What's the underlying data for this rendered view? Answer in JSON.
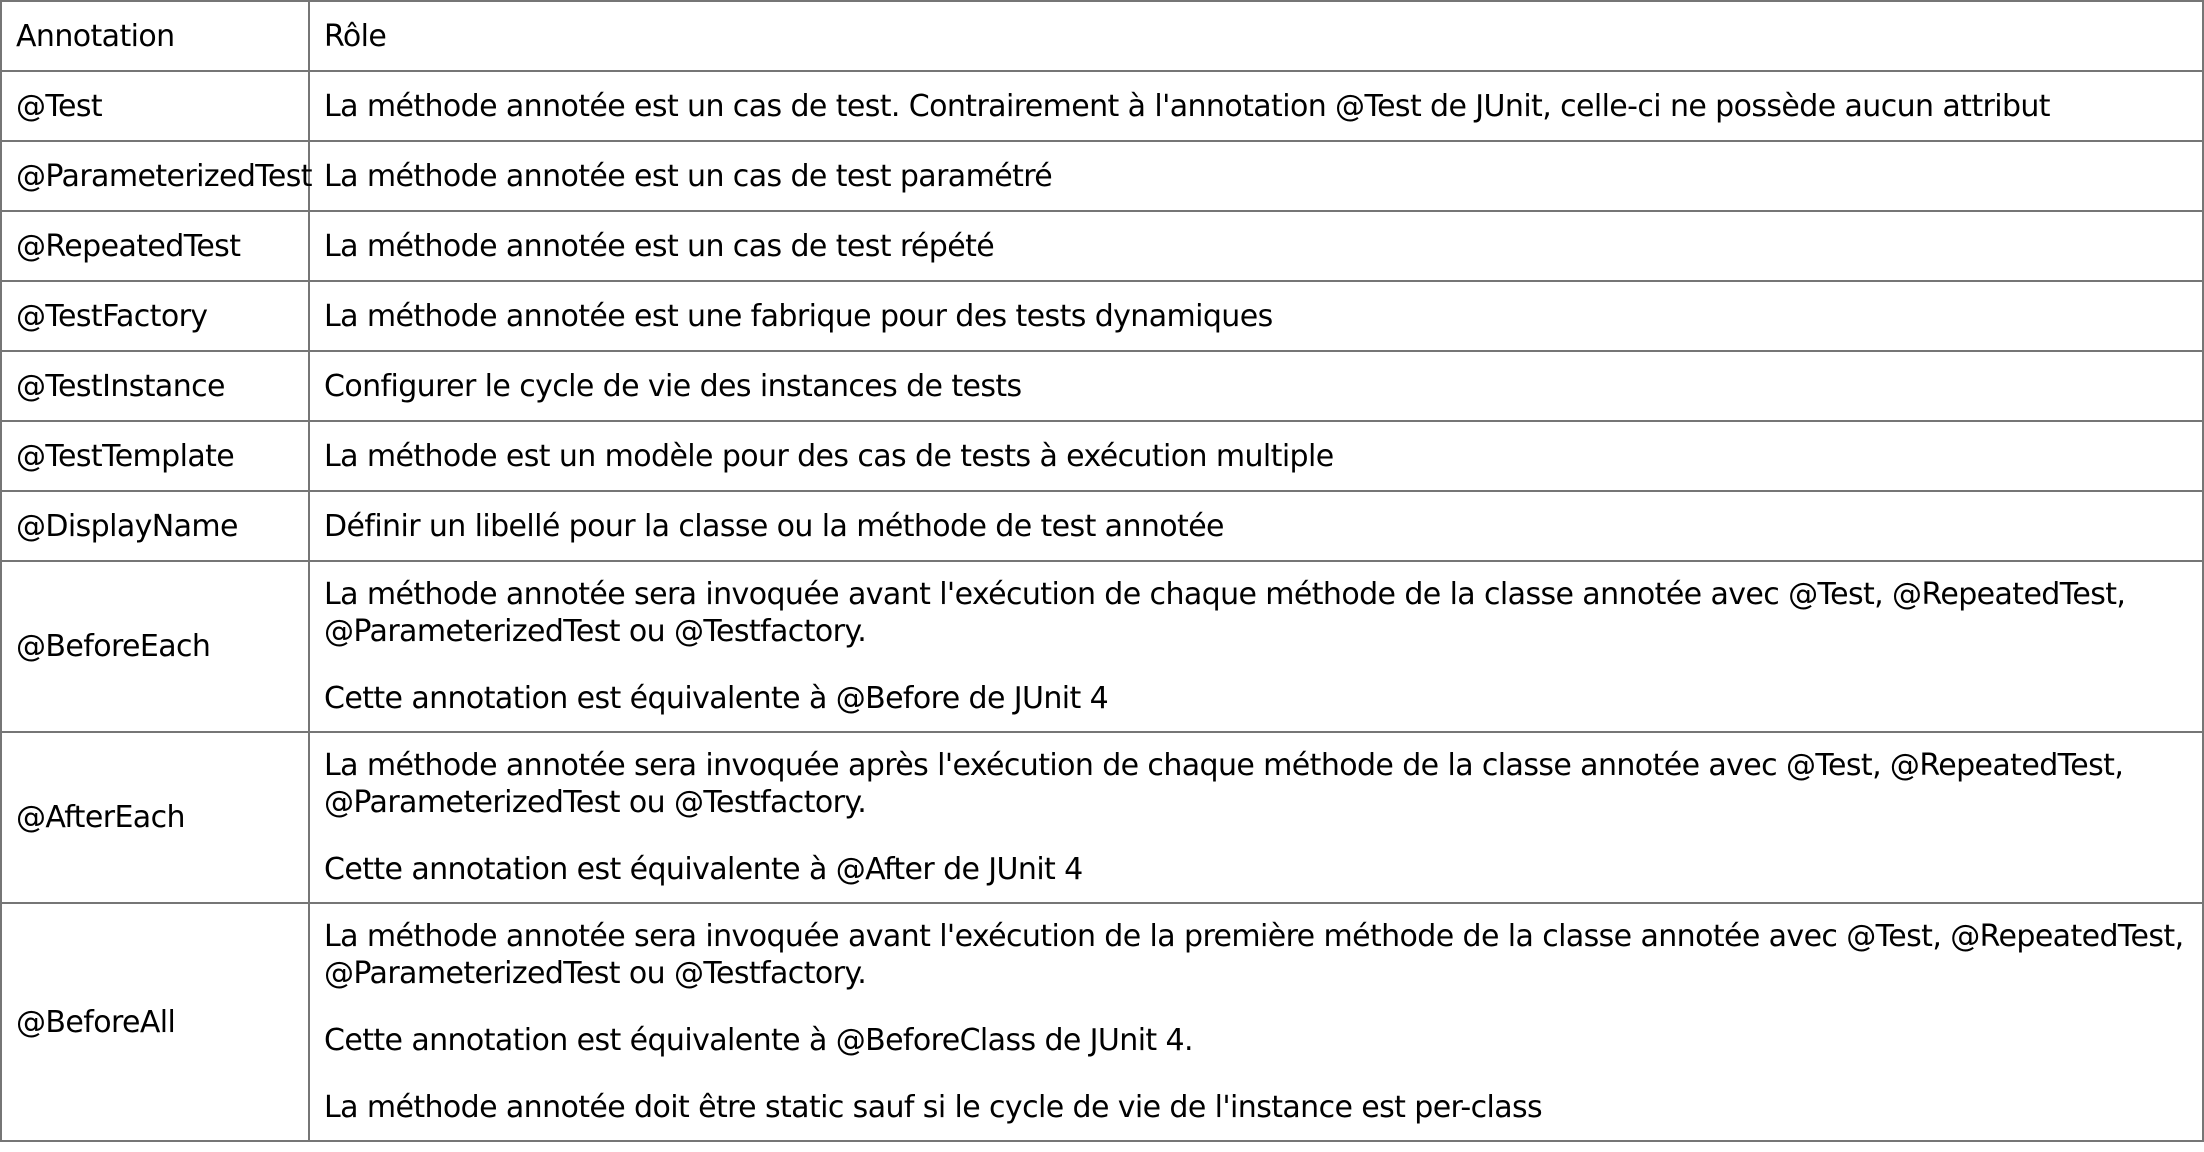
{
  "table": {
    "header": {
      "annotation": "Annotation",
      "role": "Rôle"
    },
    "rows": [
      {
        "annotation": "@Test",
        "role": [
          "La méthode annotée est un cas de test. Contrairement à l'annotation @Test de JUnit, celle-ci ne possède aucun attribut"
        ]
      },
      {
        "annotation": "@ParameterizedTest",
        "role": [
          "La méthode annotée est un cas de test paramétré"
        ]
      },
      {
        "annotation": "@RepeatedTest",
        "role": [
          "La méthode annotée est un cas de test répété"
        ]
      },
      {
        "annotation": "@TestFactory",
        "role": [
          "La méthode annotée est une fabrique pour des tests dynamiques"
        ]
      },
      {
        "annotation": "@TestInstance",
        "role": [
          "Configurer le cycle de vie des instances de tests"
        ]
      },
      {
        "annotation": "@TestTemplate",
        "role": [
          "La méthode est un modèle pour des cas de tests à exécution multiple"
        ]
      },
      {
        "annotation": "@DisplayName",
        "role": [
          "Définir un libellé pour la classe ou la méthode de test annotée"
        ]
      },
      {
        "annotation": "@BeforeEach",
        "role": [
          "La méthode annotée sera invoquée avant l'exécution de chaque méthode de la classe annotée avec @Test, @RepeatedTest, @ParameterizedTest ou @Testfactory.",
          "Cette annotation est équivalente à @Before de JUnit 4"
        ]
      },
      {
        "annotation": "@AfterEach",
        "role": [
          "La méthode annotée sera invoquée après l'exécution de chaque méthode de la classe annotée avec @Test, @RepeatedTest, @ParameterizedTest ou @Testfactory.",
          "Cette annotation est équivalente à @After de JUnit 4"
        ]
      },
      {
        "annotation": "@BeforeAll",
        "role": [
          "La méthode annotée sera invoquée avant l'exécution de la première méthode de la classe annotée avec @Test, @RepeatedTest, @ParameterizedTest ou @Testfactory.",
          "Cette annotation est équivalente à @BeforeClass de JUnit 4.",
          "La méthode annotée doit être static sauf si le cycle de vie de l'instance est per-class"
        ]
      }
    ]
  }
}
